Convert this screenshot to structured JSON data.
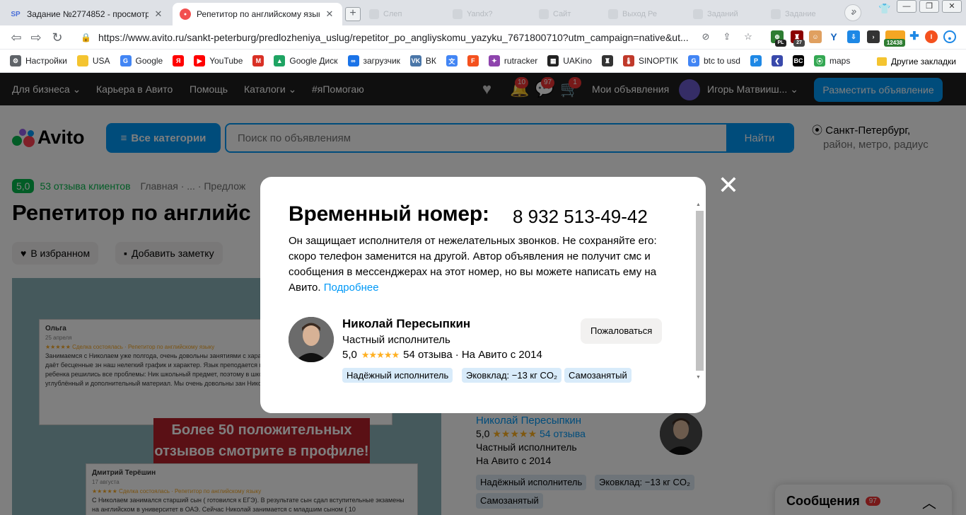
{
  "browser": {
    "tabs": [
      {
        "favicon": "SP",
        "title": "Задание №2774852 - просмотр з",
        "active": false
      },
      {
        "favicon": "●",
        "title": "Репетитор по английскому языку",
        "active": true
      }
    ],
    "bg_tabs": [
      "Слеп",
      "Yandx?",
      "Сайт",
      "Выход Ре",
      "Заданий",
      "Задание"
    ],
    "window_controls": {
      "minimize": "—",
      "maximize": "❐",
      "close": "✕"
    },
    "url": "https://www.avito.ru/sankt-peterburg/predlozheniya_uslug/repetitor_po_angliyskomu_yazyku_7671800710?utm_campaign=native&ut...",
    "extensions": {
      "pl_badge": "PL",
      "count_badge": "27",
      "counter": "12438",
      "profile_letter": "I"
    },
    "bookmarks": [
      {
        "icon": "gear-icon",
        "label": "Настройки",
        "color": "#5f6368"
      },
      {
        "icon": "folder-icon",
        "label": "USA",
        "color": "#f4c430"
      },
      {
        "icon": "google-icon",
        "label": "Google",
        "color": "#4285f4"
      },
      {
        "icon": "yandex-icon",
        "label": "",
        "color": "#ff0000"
      },
      {
        "icon": "youtube-icon",
        "label": "YouTube",
        "color": "#ff0000"
      },
      {
        "icon": "gmail-icon",
        "label": "",
        "color": "#d93025"
      },
      {
        "icon": "drive-icon",
        "label": "Google Диск",
        "color": "#1fa463"
      },
      {
        "icon": "infinity-icon",
        "label": "загрузчик",
        "color": "#1a73e8"
      },
      {
        "icon": "vk-icon",
        "label": "ВК",
        "color": "#4a76a8"
      },
      {
        "icon": "translate-icon",
        "label": "",
        "color": "#4285f4"
      },
      {
        "icon": "f-icon",
        "label": "",
        "color": "#f4511e"
      },
      {
        "icon": "rutracker-icon",
        "label": "rutracker",
        "color": "#8e44ad"
      },
      {
        "icon": "film-icon",
        "label": "UAKino",
        "color": "#222222"
      },
      {
        "icon": "bottle-icon",
        "label": "",
        "color": "#333333"
      },
      {
        "icon": "thermometer-icon",
        "label": "SINOPTIK",
        "color": "#c0392b"
      },
      {
        "icon": "google-icon",
        "label": "btc to usd",
        "color": "#4285f4"
      },
      {
        "icon": "p-icon",
        "label": "",
        "color": "#1e88e5"
      },
      {
        "icon": "arrow-icon",
        "label": "",
        "color": "#3949ab"
      },
      {
        "icon": "bc-icon",
        "label": "",
        "color": "#000000"
      },
      {
        "icon": "maps-icon",
        "label": "maps",
        "color": "#34a853"
      }
    ],
    "bookmarks_more": "»",
    "other_bookmarks": "Другие закладки"
  },
  "avito": {
    "topbar": {
      "for_business": "Для бизнеса",
      "career": "Карьера в Авито",
      "help": "Помощь",
      "catalogs": "Каталоги",
      "help_tag": "#яПомогаю",
      "notif_badge": "10",
      "msg_badge": "97",
      "cart_badge": "1",
      "my_ads": "Мои объявления",
      "user": "Игорь Матвииш...",
      "place_ad": "Разместить объявление"
    },
    "header": {
      "logo": "Avito",
      "all_categories": "Все категории",
      "search_placeholder": "Поиск по объявлениям",
      "search_button": "Найти",
      "city": "Санкт-Петербург,",
      "location_hint": "район, метро, радиус"
    },
    "breadcrumb": {
      "rating": "5,0",
      "reviews": "53 отзыва клиентов",
      "path": "Главная · ... · Предлож"
    },
    "title": "Репетитор по английс",
    "favorite": "В избранном",
    "add_note": "Добавить заметку",
    "gallery": {
      "review1_name": "Ольга",
      "review1_date": "25 апреля",
      "review1_meta": "★★★★★ Сделка состоялась · Репетитор по английскому языку",
      "review1_text": "Занимаемся с Николаем уже полгода, очень довольны занятиями с характером. Спасибо Николаю, он не только даёт бесценные зн наш нелегкий график и характер. Язык преподается в очень дост углубленным английским у ребенка решились все проблемы: Ник школьный предмет, поэтому в школе только отличные оценки, та углублённый и дополнительный материал. Мы очень довольны зан Николая, как преподавател",
      "promo": "Более 50 положительных отзывов смотрите в профиле!",
      "review2_name": "Дмитрий Терёшин",
      "review2_date": "17 августа",
      "review2_meta": "★★★★★ Сделка состоялась · Репетитор по английскому языку",
      "review2_text": "С Николаем занимался старший сын ( готовился к ЕГЭ). В результате сын сдал вступительные экзамены на английском в университет в ОАЭ. Сейчас Николай занимается с младшим сыном ( 10"
    },
    "seller": {
      "name": "Николай Пересыпкин",
      "rating": "5,0",
      "stars": "★★★★★",
      "reviews": "54 отзыва",
      "type": "Частный исполнитель",
      "since": "На Авито с 2014",
      "tags": [
        "Надёжный исполнитель",
        "Эковклад: −13 кг CO₂",
        "Самозанятый"
      ]
    },
    "messages": {
      "label": "Сообщения",
      "badge": "97"
    }
  },
  "modal": {
    "close": "✕",
    "title": "Временный номер:",
    "phone": "8 932 513-49-42",
    "description": "Он защищает исполнителя от нежелательных звонков. Не сохраняйте его: скоро телефон заменится на другой. Автор объявления не получит смс и сообщения в мессенджерах на этот номер, но вы можете написать ему на Авито.",
    "more_link": "Подробнее",
    "seller_name": "Николай Пересыпкин",
    "seller_type": "Частный исполнитель",
    "rating": "5,0",
    "stars": "★★★★★",
    "reviews": "54 отзыва",
    "since": "· На Авито с 2014",
    "report": "Пожаловаться",
    "tags": [
      "Надёжный исполнитель",
      "Эковклад: −13 кг CO₂",
      "Самозанятый"
    ]
  },
  "colors": {
    "accent": "#0099f7",
    "green": "#04b84c",
    "badge": "#e33333"
  }
}
